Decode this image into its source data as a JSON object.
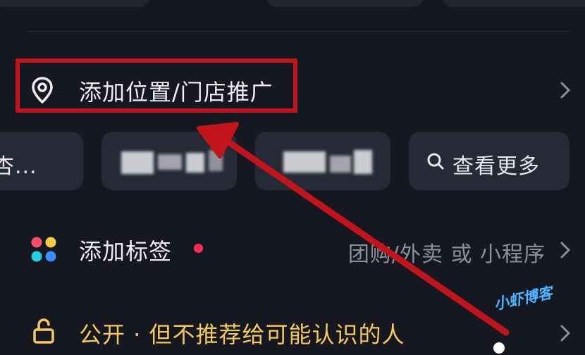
{
  "location": {
    "label": "添加位置/门店推广",
    "icon": "location-pin-icon"
  },
  "chips": [
    {
      "label": "杏...",
      "kind": "text"
    },
    {
      "label": "",
      "kind": "blurred"
    },
    {
      "label": "",
      "kind": "blurred"
    },
    {
      "label": "查看更多",
      "kind": "search",
      "icon": "search-icon"
    }
  ],
  "tag": {
    "label": "添加标签",
    "icon": "colored-dots-icon",
    "right_text": "团购/外卖 或 小程序",
    "dot_color": "#fb2c55"
  },
  "visibility": {
    "label": "公开 · 但不推荐给可能认识的人",
    "icon": "unlock-icon",
    "color": "#f5c95a"
  },
  "watermark": "小虾博客",
  "colors": {
    "background": "#161821",
    "highlight": "#c2141b",
    "chip_bg": "#262936"
  }
}
